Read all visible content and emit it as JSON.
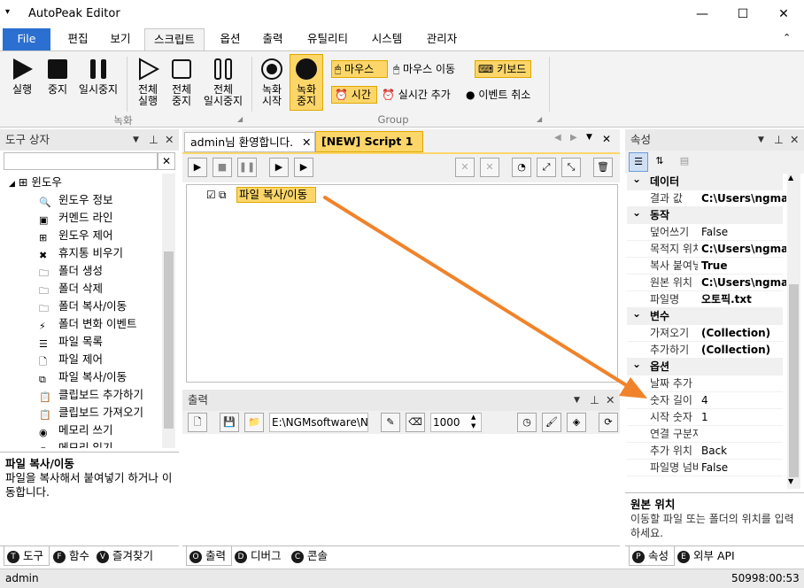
{
  "window": {
    "title": "AutoPeak Editor",
    "minimize": "—",
    "maximize": "☐",
    "close": "✕"
  },
  "ribbon_tabs": [
    "File",
    "편집",
    "보기",
    "스크립트",
    "옵션",
    "출력",
    "유틸리티",
    "시스템",
    "관리자"
  ],
  "ribbon": {
    "run": "실행",
    "stop": "중지",
    "pause": "일시중지",
    "run_all": "전체\n실행",
    "stop_all": "전체\n중지",
    "pause_all": "전체\n일시중지",
    "record_start": "녹화\n시작",
    "record_stop": "녹화\n중지",
    "mouse": "마우스",
    "mouse_move": "마우스 이동",
    "keyboard": "키보드",
    "time": "시간",
    "realtime_add": "실시간 추가",
    "event_cancel": "이벤트 취소",
    "group_record": "녹화",
    "group_group": "Group"
  },
  "toolbox": {
    "title": "도구 상자",
    "search_value": "",
    "root": "윈도우",
    "items": [
      "윈도우 정보",
      "커멘드 라인",
      "윈도우 제어",
      "휴지통 비우기",
      "폴더 생성",
      "폴더 삭제",
      "폴더 복사/이동",
      "폴더 변화 이벤트",
      "파일 목록",
      "파일 제어",
      "파일 복사/이동",
      "클립보드 추가하기",
      "클립보드 가져오기",
      "메모리 쓰기",
      "메모리 읽기"
    ],
    "desc_title": "파일 복사/이동",
    "desc_text": "파일을 복사해서 붙여넣기 하거나 이동합니다.",
    "tabs": [
      "도구",
      "함수",
      "즐겨찾기"
    ]
  },
  "editor": {
    "tabs": [
      "admin님 환영합니다.",
      "[NEW] Script 1"
    ],
    "node_label": "파일 복사/이동"
  },
  "output": {
    "title": "출력",
    "path_value": "E:\\NGMsoftware\\NG",
    "count_value": "1000",
    "tabs": [
      "출력",
      "디버그",
      "콘솔"
    ]
  },
  "properties": {
    "title": "속성",
    "categories": [
      {
        "name": "데이터",
        "rows": [
          {
            "name": "결과 값",
            "value": "C:\\Users\\ngma",
            "bold": true
          }
        ]
      },
      {
        "name": "동작",
        "rows": [
          {
            "name": "덮어쓰기",
            "value": "False",
            "bold": false
          },
          {
            "name": "목적지 위치",
            "value": "C:\\Users\\ngma",
            "bold": true
          },
          {
            "name": "복사 붙여넣기",
            "value": "True",
            "bold": true
          },
          {
            "name": "원본 위치",
            "value": "C:\\Users\\ngma",
            "bold": true
          },
          {
            "name": "파일명",
            "value": "오토픽.txt",
            "bold": true
          }
        ]
      },
      {
        "name": "변수",
        "rows": [
          {
            "name": "가져오기",
            "value": "(Collection)",
            "bold": true
          },
          {
            "name": "추가하기",
            "value": "(Collection)",
            "bold": true
          }
        ]
      },
      {
        "name": "옵션",
        "rows": [
          {
            "name": "날짜 추가",
            "value": "",
            "bold": false
          },
          {
            "name": "숫자 길이",
            "value": "4",
            "bold": false
          },
          {
            "name": "시작 숫자",
            "value": "1",
            "bold": false
          },
          {
            "name": "연결 구분자",
            "value": "",
            "bold": false
          },
          {
            "name": "추가 위치",
            "value": "Back",
            "bold": false
          },
          {
            "name": "파일명 넘버링",
            "value": "False",
            "bold": false
          }
        ]
      }
    ],
    "desc_title": "원본 위치",
    "desc_text": "이동할 파일 또는 폴더의 위치를 입력하세요.",
    "tabs": [
      "속성",
      "외부 API"
    ]
  },
  "status": {
    "user": "admin",
    "time": "50998:00:53"
  },
  "colors": {
    "accent": "#2b6fd1",
    "highlight": "#fdd66a",
    "arrow": "#f0832a"
  }
}
